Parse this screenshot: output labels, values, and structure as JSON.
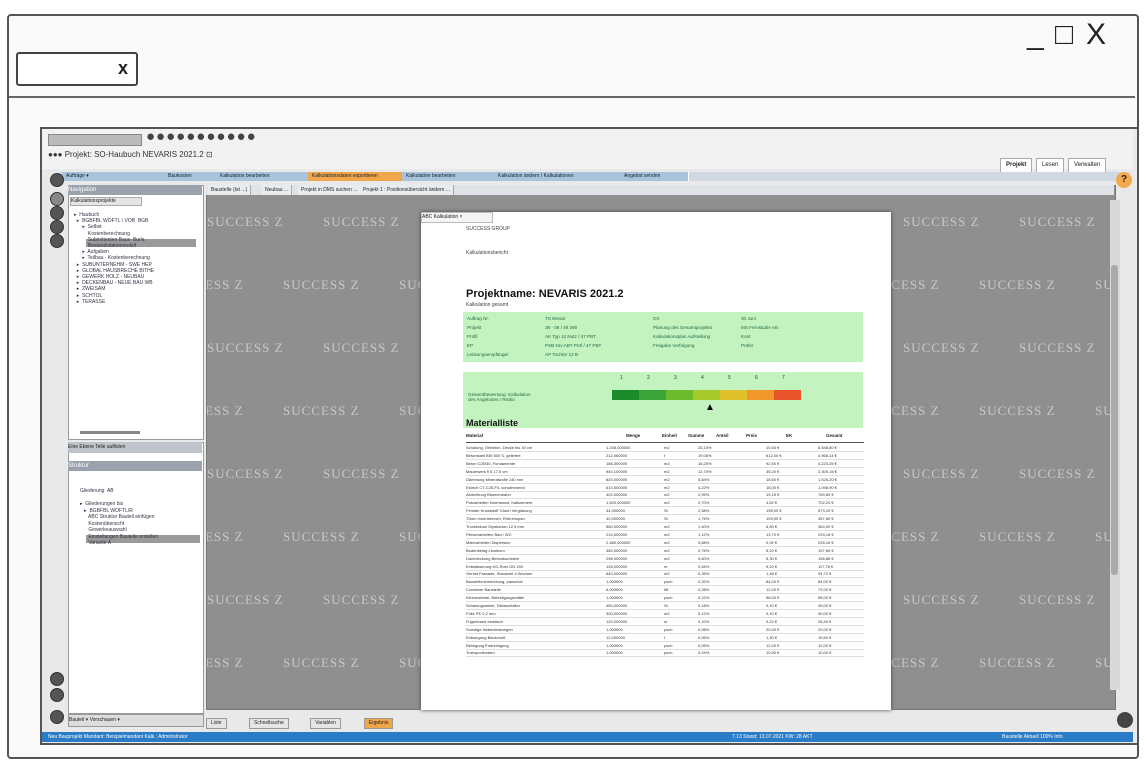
{
  "browser": {
    "tab_close": "x",
    "window_controls": {
      "minimize": "_",
      "maximize": "□",
      "close": "X"
    }
  },
  "app": {
    "dots": "●●●●●●●●●●●",
    "project_line": "●●● Projekt: SO-Haubuch NEVARIS 2021.2 ⊡",
    "right_tabs": [
      "Projekt",
      "Lesen",
      "Verwalten"
    ],
    "ribbon": [
      {
        "label": "Aufträge ▾"
      },
      {
        "label": "Baukosten"
      },
      {
        "label": "Kalkulation bearbeiten"
      },
      {
        "label": "Kalkulationsdaten exportieren",
        "highlight": true
      },
      {
        "label": "Kalkulation bearbeiten"
      },
      {
        "label": "Kalkulation ändern / Kalkulationen"
      },
      {
        "label": "Angebot senden"
      }
    ],
    "help": "?",
    "nav": {
      "header": "Navigation",
      "tab": "Kalkulationsprojekte",
      "tree": "▸  Haubuch\n  ▸  BGBFBL WOFTL / VOB  BGB\n      ▸  Selbst\n          Kostenberechnung\n          Submittenten Baus  Burla\n          Bestandsdatenmodell\n      ▸  Aufgaben\n      ▸  Teilbau - Kostenberechnung\n  ▸  SUBUNTERNEHM - SWE HEP\n  ▸  GLOBAL HAUSBRECHE BITHE\n  ▸  GEWERK HOLZ - NEUBAU\n  ▸  DECKENBAU - NEUE BAU WB\n  ▸  ZWEISAM\n  ▸  SCHTOL\n  ▸  TERASSE",
      "panel2_header": "Eine Ebene   Teile auflisten",
      "panel2_title": "Struktur",
      "tree2": "Gliederung  AB\n\n▸  Gliederungen bis\n   ▸  BGBFBL WOFTL/R\n      ABC Struktur Bauteil einfügen\n      Kostenübersicht\n      Gewerkeauswahl\n      Einstellungen Bauteile erstellen\n      Variante A",
      "bottom": "Bauteil ▾   Vorschauen   ▾"
    },
    "work_tabs": [
      "Baustelle (Ist ...)",
      "Neubau ...",
      "Projekt in DMS suchen ...",
      "Projekt 1 : Positionsübersicht ändern ..."
    ],
    "watermark": "SUCCESS Z",
    "bottom_tabs": [
      {
        "label": "Liste"
      },
      {
        "label": "Schnellsuche"
      },
      {
        "label": "Variablen"
      },
      {
        "label": "Ergebnis",
        "highlight": true
      }
    ],
    "status": {
      "left": "Neu Bauprojekt   Mandant: Beispielmandant   Kalk.: Administrator",
      "mid": "7.13   Stand: 13.07.2021   KW: 28   AKT",
      "right": "Baustelle   Aktuell   100%   Info"
    }
  },
  "doc": {
    "tab": "ABC Kalkulation  ×",
    "top_small": "SUCCESS GROUP",
    "small2": "Kalkulationsbericht",
    "title": "Projektname:  NEVARIS 2021.2",
    "subtitle": "Kalkulation gesamt",
    "green_rows": [
      [
        "Auftrag Nr.",
        "TS Monat",
        "Ort",
        "30 Juni"
      ],
      [
        "Projekt",
        "38 - 09 / 49 390",
        "Planung des Gesamtprojekts",
        "MS Fernstudie AB"
      ],
      [
        "Profil",
        "AK Typ 12 Nutz / 47 PBT",
        "Kalkulationsplan Aufstellung",
        "Kont"
      ],
      [
        "EP",
        "PSB Nrv ABT Prüf / 47 PBT",
        "Freigabe Verfolgung",
        "Prüfer"
      ],
      [
        "Leistungsempfänger",
        "AP Tochter 12 B",
        "",
        ""
      ]
    ],
    "score_label": "Gesamtbewertung: Kalkulation des Angebotes / Risiko",
    "scale_numbers": [
      "1",
      "2",
      "3",
      "4",
      "5",
      "6",
      "7"
    ],
    "marker": "▲",
    "material_heading": "Materialliste",
    "table_headers": [
      "Material",
      "Menge",
      "Einheit",
      "Summe",
      "Anteil",
      "Preis",
      "EK",
      "Gesamt"
    ],
    "rows": [
      [
        "Schalung, Ortbeton, Decke bis 30 cm",
        "1.248,000000",
        "m2",
        "25,15%",
        "10,54 €",
        "6.548,60 €"
      ],
      [
        "Betonstahl BSt 500 S, geliefert",
        "212,460000",
        "t",
        "19,06%",
        "612,00 €",
        "4.968,14 €"
      ],
      [
        "Beton C25/30, Fundamente",
        "188,300000",
        "m3",
        "16,20%",
        "92,50 €",
        "4.223,25 €"
      ],
      [
        "Mauerwerk KS 17,5 cm",
        "940,100000",
        "m2",
        "12,70%",
        "35,20 €",
        "3.309,15 €"
      ],
      [
        "Dämmung Mineralwolle 140 mm",
        "820,000000",
        "m2",
        "5,84%",
        "18,60 €",
        "1.525,20 €"
      ],
      [
        "Estrich CT-C25-F4, schwimmend",
        "610,500000",
        "m2",
        "4,22%",
        "18,00 €",
        "1.098,90 €"
      ],
      [
        "Abdichtung Bitumenbahn",
        "402,000000",
        "m2",
        "2,95%",
        "19,15 €",
        "769,83 €"
      ],
      [
        "Putzarbeiten Innenwand, Kalkzement",
        "1.520,000000",
        "m2",
        "2,70%",
        "4,62 €",
        "702,24 €"
      ],
      [
        "Fenster Kunststoff 3-fach Verglasung",
        "34,000000",
        "St",
        "2,58%",
        "198,00 €",
        "673,20 €"
      ],
      [
        "Türen Innenbereich, Röhrenspan",
        "42,000000",
        "St",
        "1,76%",
        "109,00 €",
        "457,80 €"
      ],
      [
        "Trockenbau Gipskarton 12,5 mm",
        "560,000000",
        "m2",
        "1,40%",
        "6,50 €",
        "364,00 €"
      ],
      [
        "Fliesenarbeiten Bad / WC",
        "214,000000",
        "m2",
        "1,12%",
        "13,70 €",
        "293,18 €"
      ],
      [
        "Malerarbeiten Dispersion",
        "2.480,000000",
        "m2",
        "0,88%",
        "0,92 €",
        "228,16 €"
      ],
      [
        "Bodenbelag Linoleum",
        "380,000000",
        "m2",
        "0,76%",
        "5,20 €",
        "197,60 €"
      ],
      [
        "Dachdeckung Betondachstein",
        "296,000000",
        "m2",
        "0,60%",
        "5,30 €",
        "156,88 €"
      ],
      [
        "Entwässerung KG-Rohr DN 150",
        "128,000000",
        "m",
        "0,45%",
        "9,20 €",
        "117,76 €"
      ],
      [
        "Gerüst Fassade, Standzeit 4 Wochen",
        "640,000000",
        "m2",
        "0,36%",
        "1,48 €",
        "94,72 €"
      ],
      [
        "Baustelleneinrichtung, pauschal",
        "1,000000",
        "psch",
        "0,32%",
        "84,00 €",
        "84,00 €"
      ],
      [
        "Container Baustelle",
        "6,000000",
        "Mt",
        "0,28%",
        "12,00 €",
        "72,00 €"
      ],
      [
        "Kleinmaterial, Befestigungsmittel",
        "1,000000",
        "psch",
        "0,22%",
        "58,00 €",
        "58,00 €"
      ],
      [
        "Schalungsanker, Distanzhalter",
        "450,000000",
        "St",
        "0,18%",
        "0,10 €",
        "45,00 €"
      ],
      [
        "Folie PE 0,2 mm",
        "300,000000",
        "m2",
        "0,12%",
        "0,10 €",
        "30,00 €"
      ],
      [
        "Fugenband elastisch",
        "120,000000",
        "m",
        "0,10%",
        "0,22 €",
        "26,40 €"
      ],
      [
        "Sonstige Nebenleistungen",
        "1,000000",
        "psch",
        "0,08%",
        "20,00 €",
        "20,00 €"
      ],
      [
        "Entsorgung Bauschutt",
        "12,000000",
        "t",
        "0,06%",
        "1,30 €",
        "15,60 €"
      ],
      [
        "Reinigung Endreinigung",
        "1,000000",
        "psch",
        "0,05%",
        "12,00 €",
        "12,00 €"
      ],
      [
        "Transportkosten",
        "1,000000",
        "psch",
        "0,04%",
        "10,00 €",
        "10,00 €"
      ]
    ]
  },
  "colors": {
    "accent_blue": "#2a7cc7",
    "highlight_orange": "#f0a64a",
    "green_box": "#c3f4c0",
    "scale": [
      "#1a8a2a",
      "#3aa33a",
      "#6cbb2e",
      "#a8c92c",
      "#e0c12c",
      "#f0972c",
      "#e8552a"
    ]
  }
}
